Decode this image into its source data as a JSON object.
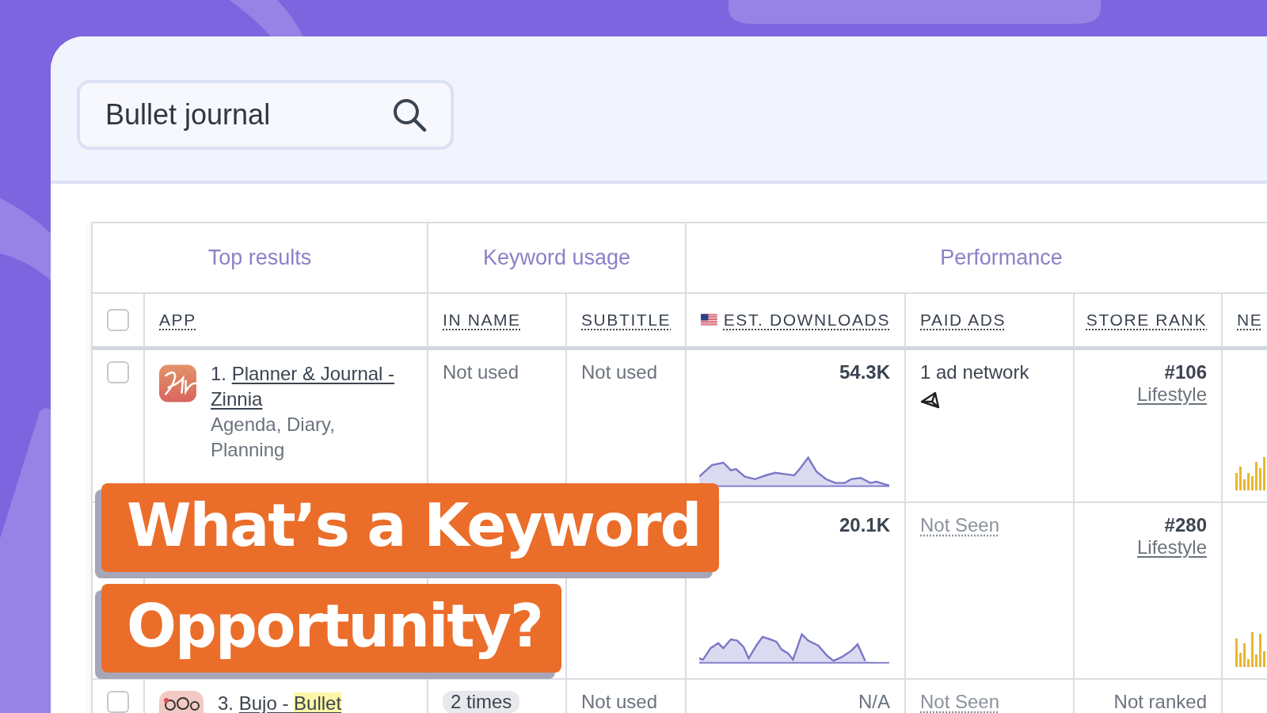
{
  "search": {
    "value": "Bullet journal"
  },
  "table": {
    "groups": [
      {
        "label": "Top results"
      },
      {
        "label": "Keyword usage"
      },
      {
        "label": "Performance"
      }
    ],
    "header_checkbox": {
      "checked": false
    },
    "columns": [
      "APP",
      "IN NAME",
      "SUBTITLE",
      "EST. DOWNLOADS",
      "PAID ADS",
      "STORE RANK",
      "NE"
    ],
    "rows": [
      {
        "checkbox": {
          "checked": false
        },
        "rank": "1.",
        "name": "Planner & Journal - Zinnia",
        "description": "Agenda, Diary, Planning",
        "in_name": {
          "kind": "text",
          "text": "Not used"
        },
        "subtitle": {
          "kind": "text",
          "text": "Not used"
        },
        "downloads": {
          "kind": "value",
          "text": "54.3K"
        },
        "paid_ads": {
          "kind": "networks",
          "text": "1 ad network"
        },
        "store_rank": {
          "kind": "value",
          "text": "#106",
          "category": "Lifestyle"
        }
      },
      {
        "downloads": {
          "kind": "value",
          "text": "20.1K"
        },
        "paid_ads": {
          "kind": "not_seen",
          "text": "Not Seen"
        },
        "store_rank": {
          "kind": "value",
          "text": "#280",
          "category": "Lifestyle"
        }
      },
      {
        "checkbox": {
          "checked": false
        },
        "rank": "3.",
        "name": "Bujo - ",
        "highlight": "Bullet",
        "in_name": {
          "kind": "badge",
          "text": "2 times"
        },
        "subtitle": {
          "kind": "text",
          "text": "Not used"
        },
        "downloads": {
          "kind": "none",
          "text": "N/A"
        },
        "paid_ads": {
          "kind": "not_seen",
          "text": "Not Seen"
        },
        "store_rank": {
          "kind": "none",
          "text": "Not ranked"
        }
      }
    ]
  },
  "title_lines": [
    "What’s a Keyword",
    "Opportunity?"
  ]
}
